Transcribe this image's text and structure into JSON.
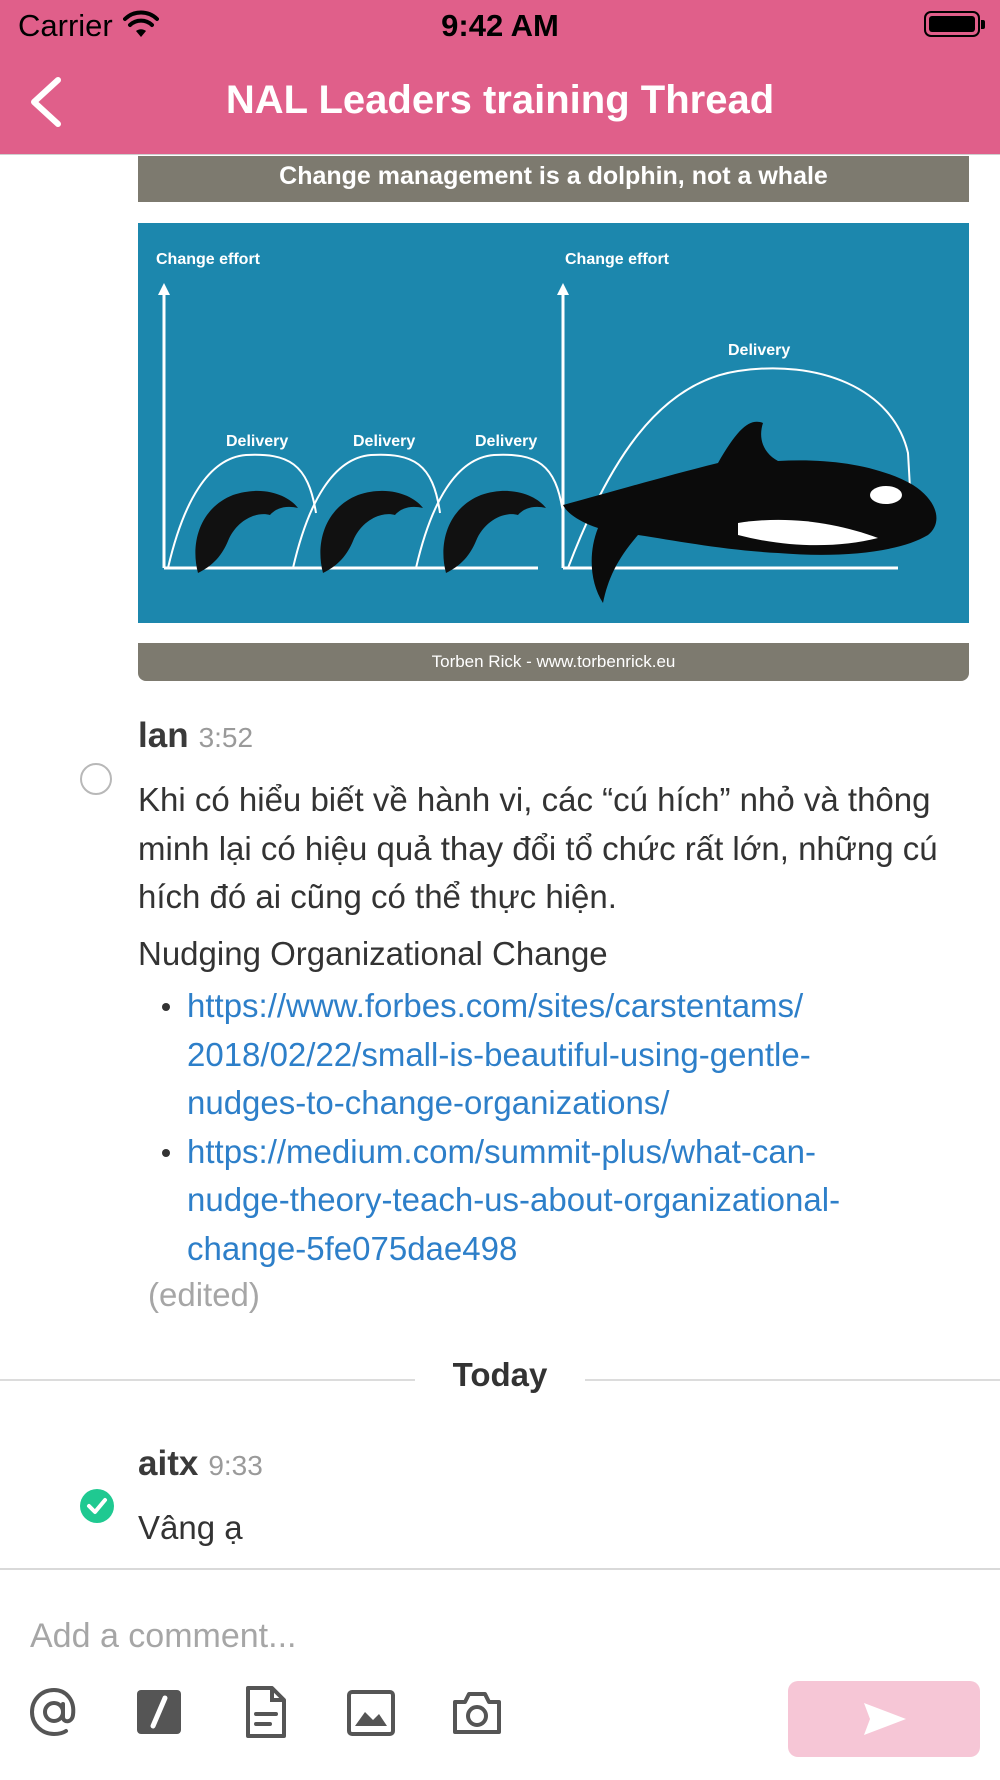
{
  "status_bar": {
    "carrier": "Carrier",
    "time": "9:42 AM"
  },
  "nav": {
    "title": "NAL Leaders training Thread",
    "back_icon": "chevron-left-icon"
  },
  "attachment": {
    "header": "Change management is a dolphin, not a whale",
    "axis_left": "Change effort",
    "axis_right": "Change effort",
    "delivery_1": "Delivery",
    "delivery_2": "Delivery",
    "delivery_3": "Delivery",
    "delivery_big": "Delivery",
    "footer": "Torben Rick - www.torbenrick.eu"
  },
  "messages": [
    {
      "author": "lan",
      "time": "3:52",
      "text": "Khi có hiểu biết về hành vi, các “cú hích” nhỏ và thông minh lại có hiệu quả thay đổi tổ chức rất lớn, những cú hích đó ai cũng có thể thực hiện.",
      "link_heading": "Nudging Organizational Change",
      "links": [
        "https://www.forbes.com/sites/carstentams/2018/02/22/small-is-beautiful-using-gentle-nudges-to-change-organizations/",
        "https://medium.com/summit-plus/what-can-nudge-theory-teach-us-about-organizational-change-5fe075dae498"
      ],
      "edited": "(edited)"
    },
    {
      "author": "aitx",
      "time": "9:33",
      "text": "Vâng ạ"
    }
  ],
  "date_divider": "Today",
  "composer": {
    "placeholder": "Add a comment...",
    "tools": [
      "at-icon",
      "slash-command-icon",
      "file-icon",
      "image-icon",
      "camera-icon"
    ],
    "send_icon": "send-icon"
  },
  "colors": {
    "nav_bar": "#e05f8a",
    "link": "#2d7fc9",
    "send_disabled": "#f6c6d6",
    "check": "#1fc991"
  }
}
